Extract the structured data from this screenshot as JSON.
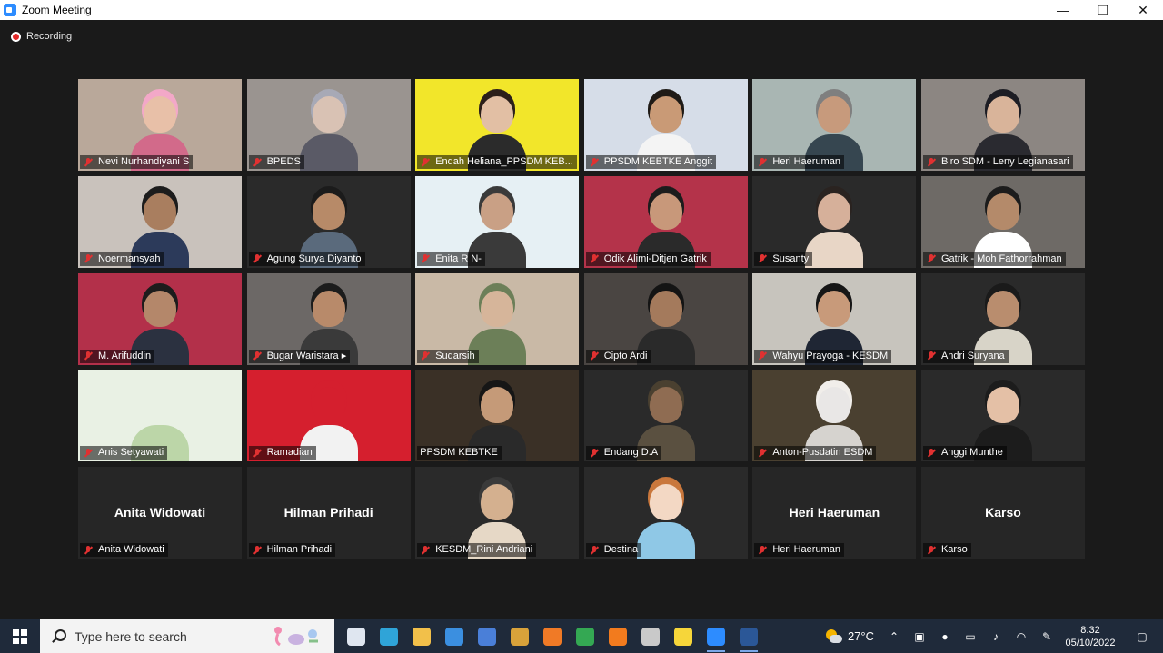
{
  "window": {
    "title": "Zoom Meeting",
    "controls": {
      "minimize": "—",
      "restore": "❐",
      "close": "✕"
    }
  },
  "meeting": {
    "recording_label": "Recording",
    "tiles": [
      {
        "name": "Nevi Nurhandiyani S",
        "bg": "#b9a89a",
        "skin": "#e8c0a8",
        "hair": "#f3a8c8",
        "cloth": "#d26a8a"
      },
      {
        "name": "BPEDS",
        "bg": "#9a9490",
        "skin": "#d9c2b4",
        "hair": "#a7a9b6",
        "cloth": "#5a5a66"
      },
      {
        "name": "Endah Heliana_PPSDM KEB...",
        "bg": "#f2e62a",
        "skin": "#e2bfa4",
        "hair": "#2b1f1a",
        "cloth": "#2b2b2b"
      },
      {
        "name": "PPSDM KEBTKE Anggit",
        "bg": "#d6dde8",
        "skin": "#c99a76",
        "hair": "#1f1a16",
        "cloth": "#f4f4f4"
      },
      {
        "name": "Heri Haeruman",
        "bg": "#a9b6b3",
        "skin": "#c79a7c",
        "hair": "#7f7f7f",
        "cloth": "#364650"
      },
      {
        "name": "Biro SDM - Leny Legianasari",
        "bg": "#8c8682",
        "skin": "#d9b49a",
        "hair": "#1d1d24",
        "cloth": "#2a2a30"
      },
      {
        "name": "Noermansyah",
        "bg": "#c9c2bc",
        "skin": "#a97e5f",
        "hair": "#1c1c1c",
        "cloth": "#2c3a5a"
      },
      {
        "name": "Agung Surya Diyanto",
        "bg": "#2a2a2a",
        "skin": "#b78a68",
        "hair": "#1b1b1b",
        "cloth": "#5a6a7c"
      },
      {
        "name": "Enita R N-",
        "bg": "#e6f0f4",
        "skin": "#c9a085",
        "hair": "#3a3a3a",
        "cloth": "#3a3a3a"
      },
      {
        "name": "Odik Alimi-Ditjen Gatrik",
        "bg": "#b4334a",
        "skin": "#c8987a",
        "hair": "#1c1c1c",
        "cloth": "#2a2a2a"
      },
      {
        "name": "Susanty",
        "bg": "#2a2a2a",
        "skin": "#d6b09a",
        "hair": "#2a2320",
        "cloth": "#e8d6c6"
      },
      {
        "name": "Gatrik - Moh Fathorrahman",
        "bg": "#6e6a66",
        "skin": "#b48a6a",
        "hair": "#1c1c1c",
        "cloth": "#ffffff"
      },
      {
        "name": "M. Arifuddin",
        "bg": "#b3304a",
        "skin": "#b4876a",
        "hair": "#1c1c1c",
        "cloth": "#2b3140"
      },
      {
        "name": "Bugar Waristara ▸",
        "bg": "#6c6866",
        "skin": "#b88a6a",
        "hair": "#1c1c1c",
        "cloth": "#3a3a3a"
      },
      {
        "name": "Sudarsih",
        "bg": "#c9b9a6",
        "skin": "#d6b59a",
        "hair": "#6c7f58",
        "cloth": "#6c7f58"
      },
      {
        "name": "Cipto Ardi",
        "bg": "#4a4542",
        "skin": "#a47a5c",
        "hair": "#141414",
        "cloth": "#2a2a2a"
      },
      {
        "name": "Wahyu Prayoga - KESDM",
        "bg": "#c7c4bd",
        "skin": "#c89a7a",
        "hair": "#161616",
        "cloth": "#1f2634"
      },
      {
        "name": "Andri Suryana",
        "bg": "#2a2a2a",
        "skin": "#b98d6e",
        "hair": "#1a1a1a",
        "cloth": "#d8d4c8"
      },
      {
        "name": "Anis Setyawati",
        "bg": "#e9f1e4",
        "skin": "#e9f1e4",
        "hair": "#e9f1e4",
        "cloth": "#bcd6a8"
      },
      {
        "name": "Ramadian",
        "bg": "#d51f2e",
        "skin": "#d51f2e",
        "hair": "#d51f2e",
        "cloth": "#f2f2f2"
      },
      {
        "name": "PPSDM KEBTKE",
        "bg": "#3a3026",
        "skin": "#c59a78",
        "hair": "#161616",
        "cloth": "#2a2a2a",
        "active": true
      },
      {
        "name": "Endang D.A",
        "bg": "#2a2a2a",
        "skin": "#8f6c52",
        "hair": "#4a4030",
        "cloth": "#5a5040"
      },
      {
        "name": "Anton-Pusdatin ESDM",
        "bg": "#4a4030",
        "skin": "#e9e7e6",
        "hair": "#f1eeea",
        "cloth": "#d6d3cf"
      },
      {
        "name": "Anggi Munthe",
        "bg": "#2a2a2a",
        "skin": "#e4c0a6",
        "hair": "#1c1c1c",
        "cloth": "#1c1c1c"
      },
      {
        "name": "Anita Widowati",
        "big": "Anita Widowati"
      },
      {
        "name": "Hilman Prihadi",
        "big": "Hilman Prihadi"
      },
      {
        "name": "KESDM_Rini Andriani",
        "bg": "#2a2a2a",
        "skin": "#d4b08f",
        "hair": "#3a3a3a",
        "cloth": "#e6d8c6"
      },
      {
        "name": "Destina",
        "bg": "#2a2a2a",
        "skin": "#f3d8c4",
        "hair": "#c9773c",
        "cloth": "#8fc8e6"
      },
      {
        "name": "Heri Haeruman",
        "big": "Heri Haeruman"
      },
      {
        "name": "Karso",
        "big": "Karso"
      }
    ]
  },
  "taskbar": {
    "search_placeholder": "Type here to search",
    "apps": [
      {
        "name": "task-view",
        "color": "#dfe6f0",
        "running": false
      },
      {
        "name": "edge",
        "color": "#2fa4d8",
        "running": false
      },
      {
        "name": "file-explorer",
        "color": "#f2c04a",
        "running": false
      },
      {
        "name": "mail",
        "color": "#3b8fe0",
        "running": false
      },
      {
        "name": "store",
        "color": "#4a7fd8",
        "running": false
      },
      {
        "name": "app-dark",
        "color": "#d8a23a",
        "running": false
      },
      {
        "name": "firefox",
        "color": "#f07a26",
        "running": false
      },
      {
        "name": "chrome",
        "color": "#34a853",
        "running": false
      },
      {
        "name": "avast",
        "color": "#f27b1e",
        "running": false
      },
      {
        "name": "ppt-app",
        "color": "#c9c9c9",
        "running": false
      },
      {
        "name": "sticky-notes",
        "color": "#f6d63a",
        "running": false
      },
      {
        "name": "zoom",
        "color": "#2d8cff",
        "running": true
      },
      {
        "name": "word",
        "color": "#2b5797",
        "running": true
      }
    ],
    "weather": "27°C",
    "time": "8:32",
    "date": "05/10/2022"
  }
}
